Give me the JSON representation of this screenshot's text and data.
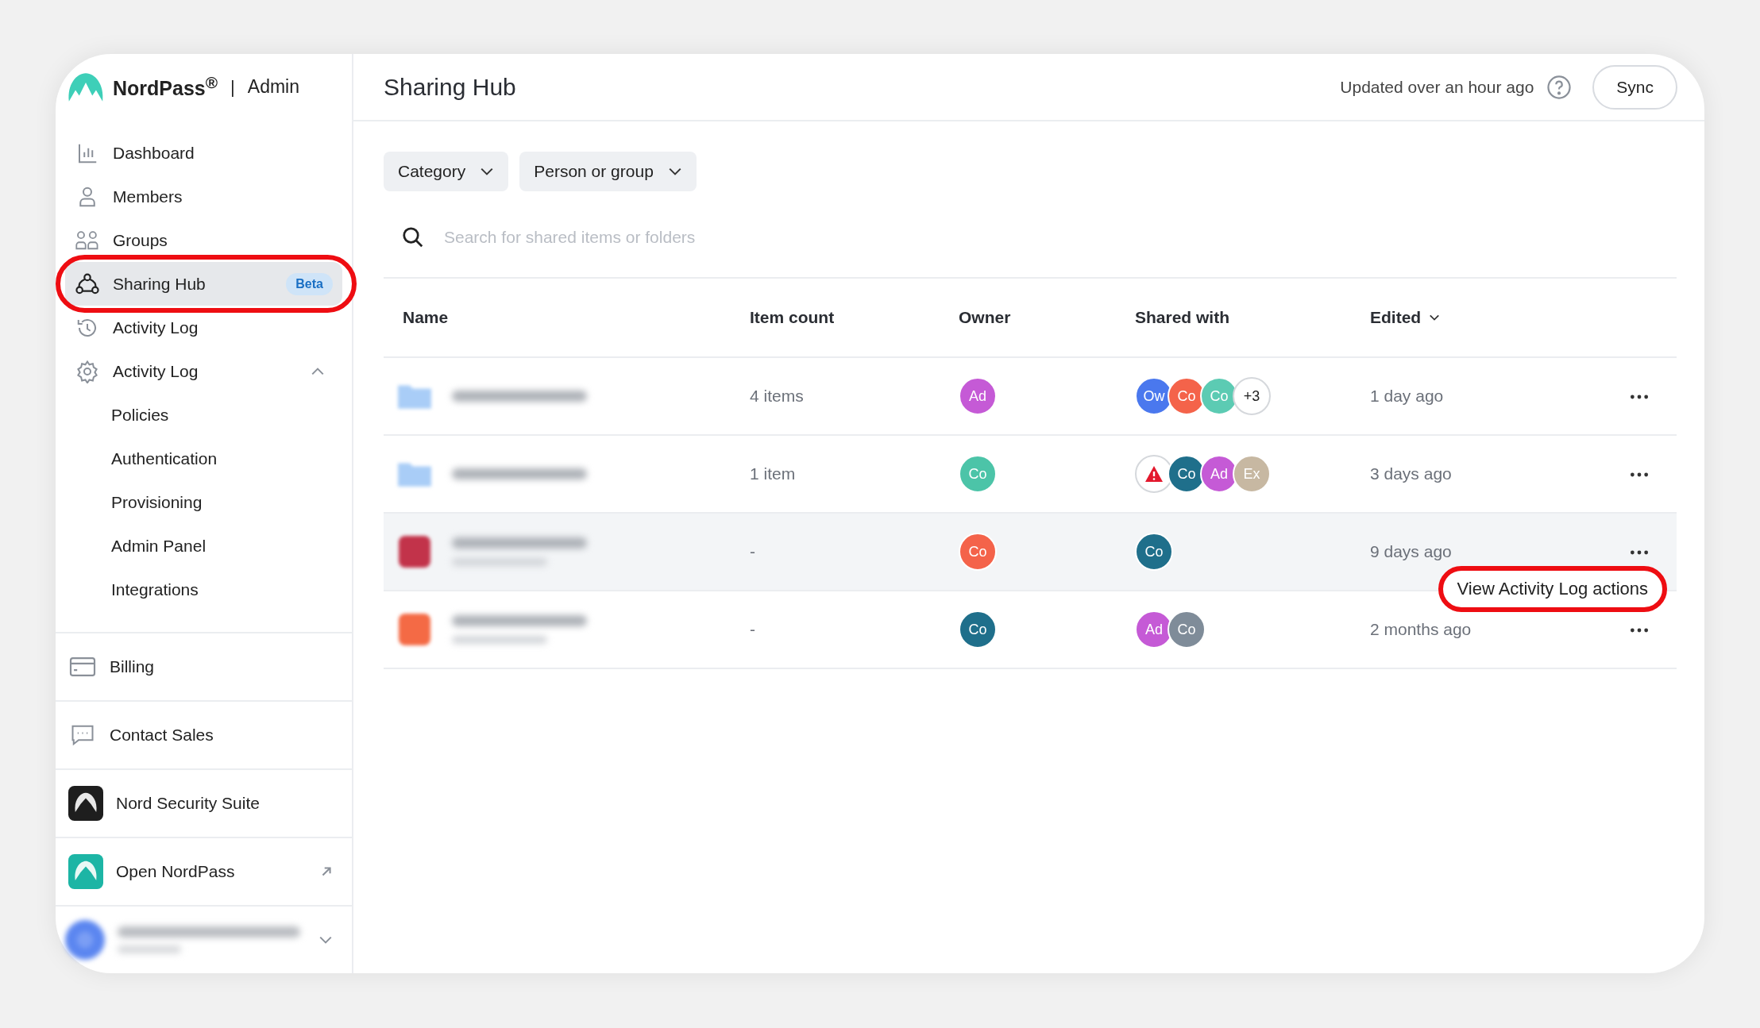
{
  "brand": {
    "name": "NordPass$^{®}$",
    "separator": "|",
    "section": "Admin"
  },
  "nav": [
    {
      "label": "Dashboard",
      "selected": false
    },
    {
      "label": "Members",
      "selected": false
    },
    {
      "label": "Groups",
      "selected": false
    },
    {
      "label": "Sharing Hub",
      "selected": true,
      "badge": "Beta",
      "highlighted": true
    },
    {
      "label": "Activity Log",
      "selected": false
    },
    {
      "label": "Activity Log",
      "selected": false,
      "expanded": true,
      "children": [
        {
          "label": "Policies",
          "selected": false
        },
        {
          "label": "Authentication",
          "selected": false
        },
        {
          "label": "Provisioning",
          "selected": false
        },
        {
          "label": "Admin Panel",
          "selected": false
        },
        {
          "label": "Integrations",
          "selected": false
        }
      ]
    }
  ],
  "bottom_nav": [
    {
      "label": "Billing",
      "kind": "plain"
    },
    {
      "label": "Contact Sales",
      "kind": "plain"
    },
    {
      "label": "Nord Security Suite",
      "kind": "app"
    },
    {
      "label": "Open NordPass",
      "kind": "external"
    }
  ],
  "header": {
    "title": "Sharing Hub",
    "status": "Updated over an hour ago",
    "button": "Sync"
  },
  "filters": [
    "Category",
    "Person or group"
  ],
  "search": {
    "placeholder": "Search for shared items or folders"
  },
  "table": {
    "columns": [
      {
        "label": "Name",
        "sorted": false
      },
      {
        "label": "Item count",
        "sorted": false
      },
      {
        "label": "Owner",
        "sorted": false
      },
      {
        "label": "Shared with",
        "sorted": false
      },
      {
        "label": "Edited",
        "sorted": true
      }
    ],
    "rows": [
      {
        "kind": "folder",
        "color": "#a9cdf7",
        "item_count": "4 items",
        "owner": {
          "initials": "Ad",
          "color": "#c55ad6"
        },
        "shared": [
          {
            "kind": "avatar",
            "initials": "Ow",
            "color": "#4a78ee"
          },
          {
            "kind": "avatar",
            "initials": "Co",
            "color": "#f4634a"
          },
          {
            "kind": "avatar",
            "initials": "Co",
            "color": "#5ccbb3"
          },
          {
            "kind": "more",
            "text": "+3"
          }
        ],
        "edited": "1 day ago",
        "selected": false
      },
      {
        "kind": "folder",
        "color": "#a9cdf7",
        "item_count": "1 item",
        "owner": {
          "initials": "Co",
          "color": "#4cc4a8"
        },
        "shared": [
          {
            "kind": "warning"
          },
          {
            "kind": "avatar",
            "initials": "Co",
            "color": "#1f6f8b"
          },
          {
            "kind": "avatar",
            "initials": "Ad",
            "color": "#c55ad6"
          },
          {
            "kind": "avatar",
            "initials": "Ex",
            "color": "#c7b8a2"
          }
        ],
        "edited": "3 days ago",
        "selected": false
      },
      {
        "kind": "app",
        "color": "#c2334a",
        "item_count": "-",
        "owner": {
          "initials": "Co",
          "color": "#f4634a"
        },
        "shared": [
          {
            "kind": "avatar",
            "initials": "Co",
            "color": "#1f6f8b"
          }
        ],
        "edited": "9 days ago",
        "selected": true,
        "callout": "View Activity Log actions"
      },
      {
        "kind": "app",
        "color": "#f46a45",
        "item_count": "-",
        "owner": {
          "initials": "Co",
          "color": "#1f6f8b"
        },
        "shared": [
          {
            "kind": "avatar",
            "initials": "Ad",
            "color": "#c55ad6"
          },
          {
            "kind": "avatar",
            "initials": "Co",
            "color": "#7f8c99"
          }
        ],
        "edited": "2 months ago",
        "selected": false
      }
    ]
  }
}
